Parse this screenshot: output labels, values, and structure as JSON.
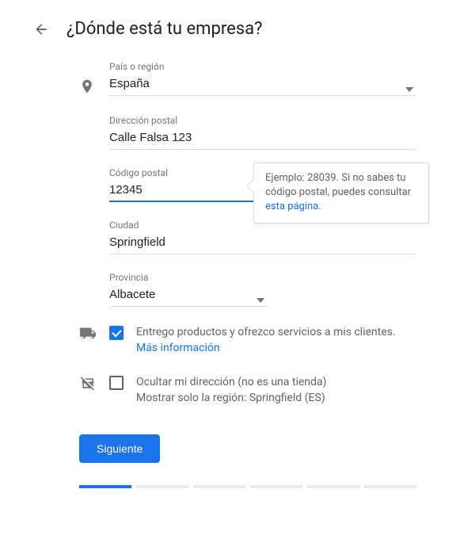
{
  "header": {
    "title": "¿Dónde está tu empresa?"
  },
  "fields": {
    "country": {
      "label": "País o región",
      "value": "España"
    },
    "street": {
      "label": "Dirección postal",
      "value": "Calle Falsa 123"
    },
    "zip": {
      "label": "Código postal",
      "value": "12345"
    },
    "city": {
      "label": "Ciudad",
      "value": "Springfield"
    },
    "province": {
      "label": "Provincia",
      "value": "Albacete"
    }
  },
  "tooltip": {
    "text_prefix": "Ejemplo: 28039. Si no sabes tu código postal, puedes consultar ",
    "link_text": "esta página",
    "text_suffix": "."
  },
  "options": {
    "deliver": {
      "checked": true,
      "text": "Entrego productos y ofrezco servicios a mis clientes. ",
      "link": "Más información"
    },
    "hide": {
      "checked": false,
      "line1": "Ocultar mi dirección (no es una tienda)",
      "line2": "Mostrar solo la región: Springfield (ES)"
    }
  },
  "actions": {
    "next": "Siguiente"
  },
  "progress": {
    "active": 0,
    "total": 6
  }
}
